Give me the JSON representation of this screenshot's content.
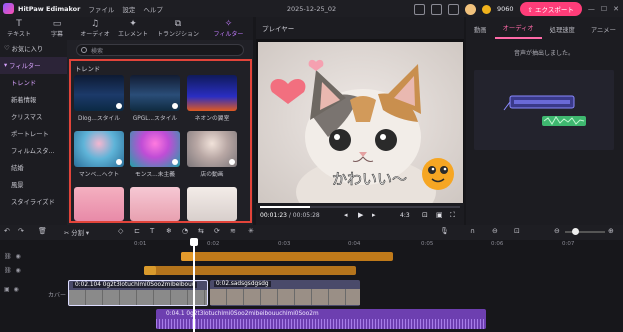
{
  "titlebar": {
    "app_name": "HitPaw Edimakor",
    "menu": [
      "ファイル",
      "設定",
      "ヘルプ"
    ],
    "project_title": "2025-12-25_02",
    "credits": "9060",
    "export_label": "エクスポート"
  },
  "tools": [
    {
      "glyph": "T",
      "label": "テキスト"
    },
    {
      "glyph": "▭",
      "label": "字幕"
    },
    {
      "glyph": "♫",
      "label": "オーディオ"
    },
    {
      "glyph": "✦",
      "label": "エレメント"
    },
    {
      "glyph": "⧉",
      "label": "トランジション"
    },
    {
      "glyph": "✧",
      "label": "フィルター"
    }
  ],
  "categories": [
    {
      "label": "お気に入り"
    },
    {
      "label": "フィルター"
    },
    {
      "label": "トレンド"
    },
    {
      "label": "新着情報"
    },
    {
      "label": "クリスマス"
    },
    {
      "label": "ポートレート"
    },
    {
      "label": "フィルムスタ..."
    },
    {
      "label": "結婚"
    },
    {
      "label": "風景"
    },
    {
      "label": "スタイライズド"
    }
  ],
  "effects": {
    "search_placeholder": "検索",
    "section_title": "トレンド",
    "tiles": [
      {
        "label": "Dlog...スタイル"
      },
      {
        "label": "GPGL...スタイル"
      },
      {
        "label": "ネオンの翼室"
      },
      {
        "label": "マンベ...ヘクト"
      },
      {
        "label": "モンス...未主義"
      },
      {
        "label": "店の動画"
      },
      {
        "label": ""
      },
      {
        "label": ""
      },
      {
        "label": ""
      }
    ]
  },
  "player": {
    "title": "プレイヤー",
    "caption": "かわいい～",
    "current_time": "00:01:23",
    "total_time": "00:05:28",
    "progress": 0.25,
    "ratio": "4:3"
  },
  "right_panel": {
    "tabs": [
      "動画",
      "オーディオ",
      "処理速度",
      "アニメー"
    ],
    "note": "音声が抽出しました。"
  },
  "timeline": {
    "split_label": "分割",
    "ruler": [
      "0:01",
      "0:02",
      "0:03",
      "0:04",
      "0:05",
      "0:06",
      "0:07"
    ],
    "cover_label": "カバー",
    "clip_main": "0:02.104 0g2t3lotuchlmi0Soo2mibeibouu",
    "clip_second": "0:02.sadsgsdgsdg",
    "clip_audio": "0:04.1 0g2t3lotuchlmi0Soo2mibeibouuchlmi0Soo2m"
  }
}
